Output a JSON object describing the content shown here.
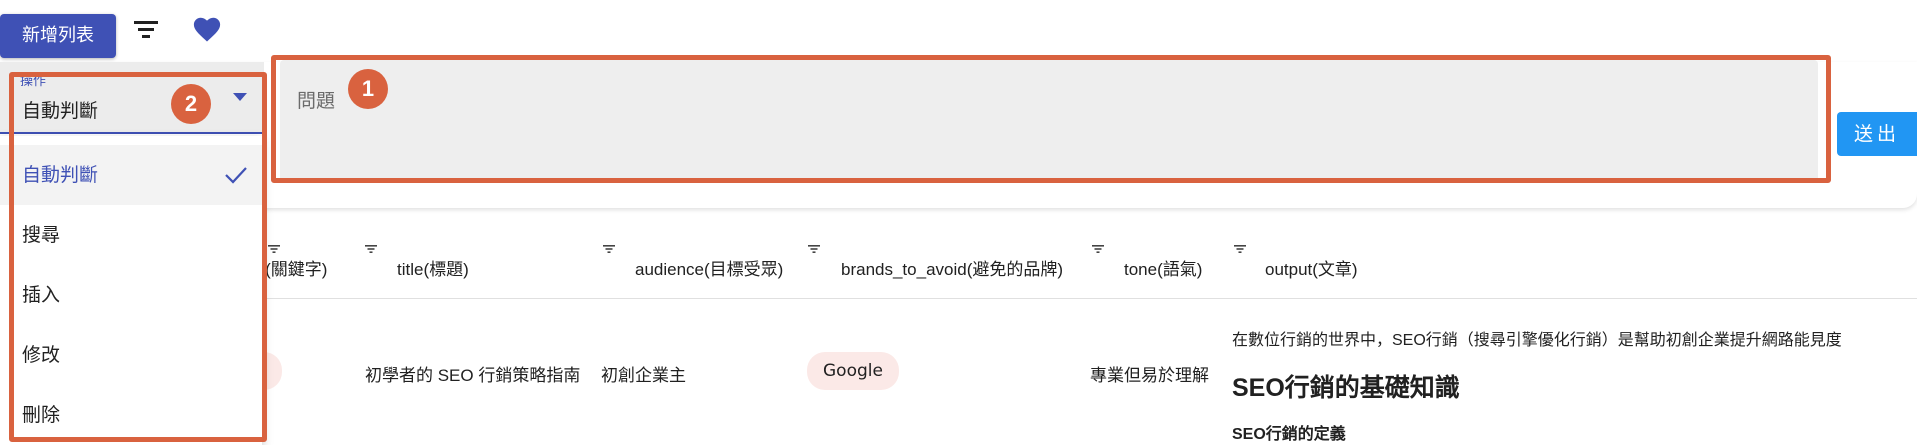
{
  "toolbar": {
    "new_list_label": "新增列表",
    "filter_icon": "filter-icon",
    "favorites_icon": "heart-icon"
  },
  "question": {
    "placeholder": "問題",
    "badge": "1"
  },
  "send_label": "送出",
  "operation": {
    "label": "操作",
    "value": "自動判斷",
    "badge": "2",
    "options": [
      "自動判斷",
      "搜尋",
      "插入",
      "修改",
      "刪除"
    ],
    "selected_index": 0
  },
  "table": {
    "columns": [
      "rd(關鍵字)",
      "title(標題)",
      "audience(目標受眾)",
      "brands_to_avoid(避免的品牌)",
      "tone(語氣)",
      "output(文章)"
    ],
    "row": {
      "title": "初學者的 SEO 行銷策略指南",
      "audience": "初創企業主",
      "brands_to_avoid": "Google",
      "tone": "專業但易於理解",
      "output_intro": "在數位行銷的世界中，SEO行銷（搜尋引擎優化行銷）是幫助初創企業提升網路能見度",
      "output_heading": "SEO行銷的基礎知識",
      "output_subheading": "SEO行銷的定義"
    }
  },
  "colors": {
    "primary": "#3f51b5",
    "send": "#2196f3",
    "annotation": "#d9623f",
    "chip": "#fbe9e7"
  }
}
